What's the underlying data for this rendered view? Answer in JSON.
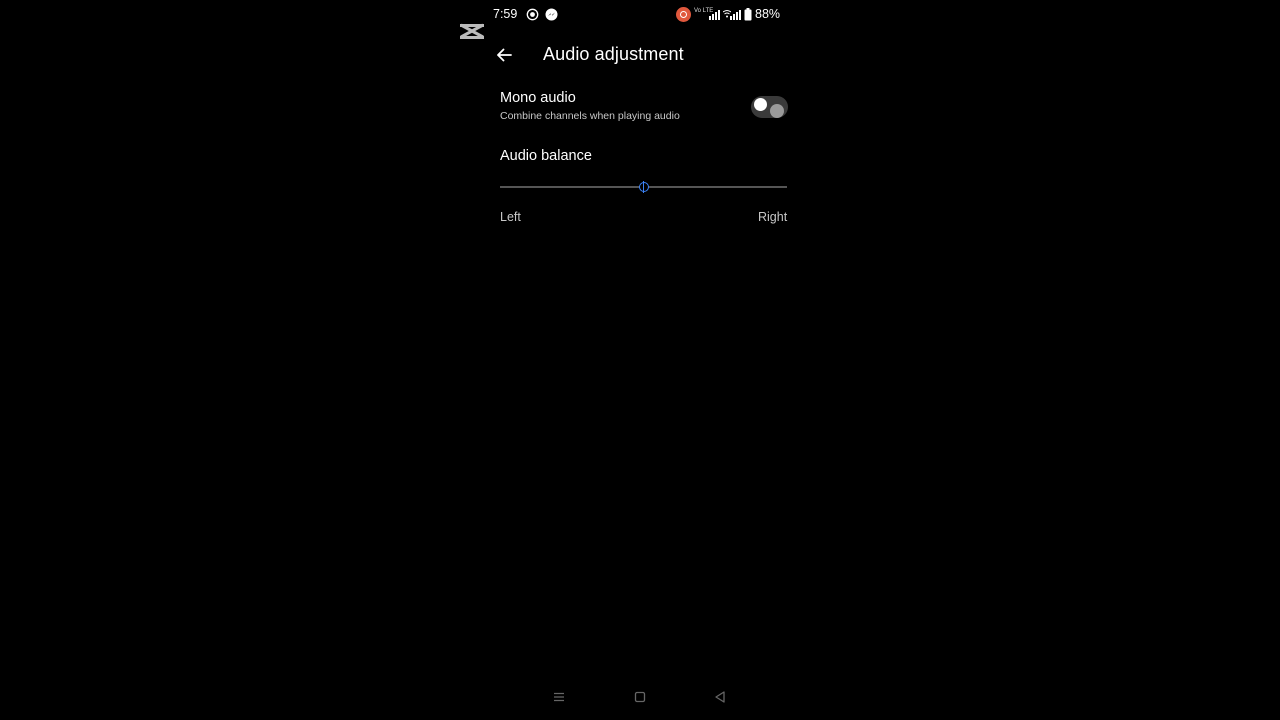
{
  "status_bar": {
    "time": "7:59",
    "battery": "88%",
    "network_label": "Vo LTE",
    "icons": [
      "screen-record-icon",
      "messenger-icon",
      "recording-indicator-icon",
      "wifi-icon",
      "signal-icon",
      "battery-icon"
    ]
  },
  "header": {
    "title": "Audio adjustment",
    "back_icon": "arrow-left-icon"
  },
  "mono_audio": {
    "title": "Mono audio",
    "subtitle": "Combine channels when playing audio",
    "enabled": false
  },
  "audio_balance": {
    "title": "Audio balance",
    "left_label": "Left",
    "right_label": "Right",
    "value": 0.5
  },
  "nav_bar": {
    "buttons": [
      "menu-icon",
      "home-icon",
      "back-icon"
    ]
  },
  "colors": {
    "background": "#000000",
    "accent": "#3b82f6",
    "text": "#ffffff",
    "secondary_text": "#c8c8c8",
    "recording": "#e0583d"
  }
}
